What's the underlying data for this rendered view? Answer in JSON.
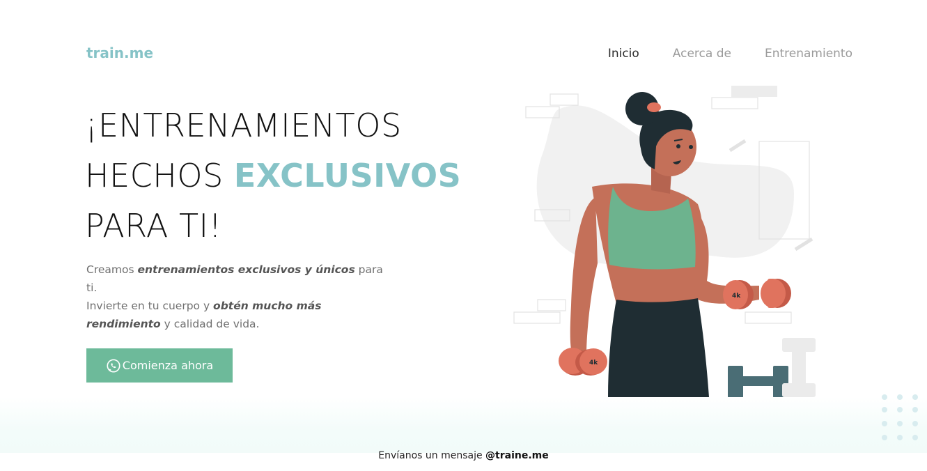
{
  "header": {
    "logo": "train.me",
    "nav": [
      {
        "label": "Inicio",
        "active": true
      },
      {
        "label": "Acerca de",
        "active": false
      },
      {
        "label": "Entrenamiento",
        "active": false
      }
    ]
  },
  "hero": {
    "title_line1": "¡ENTRENAMIENTOS",
    "title_line2_a": "HECHOS ",
    "title_line2_b": "EXCLUSIVOS",
    "title_line3": "PARA TI!",
    "desc_1": "Creamos ",
    "desc_2": "entrenamientos exclusivos y únicos",
    "desc_3": " para ti.",
    "desc_4": "Invierte en tu cuerpo y ",
    "desc_5": "obtén mucho más rendimiento",
    "desc_6": " y calidad de vida.",
    "cta_label": "Comienza ahora",
    "cta_icon": "whatsapp-icon"
  },
  "illustration": {
    "dumbbell_label": "4k"
  },
  "footer": {
    "message": "Envíanos un mensaje ",
    "handle": "@traine.me"
  },
  "colors": {
    "accent": "#86c3c7",
    "cta": "#6dba9a"
  }
}
